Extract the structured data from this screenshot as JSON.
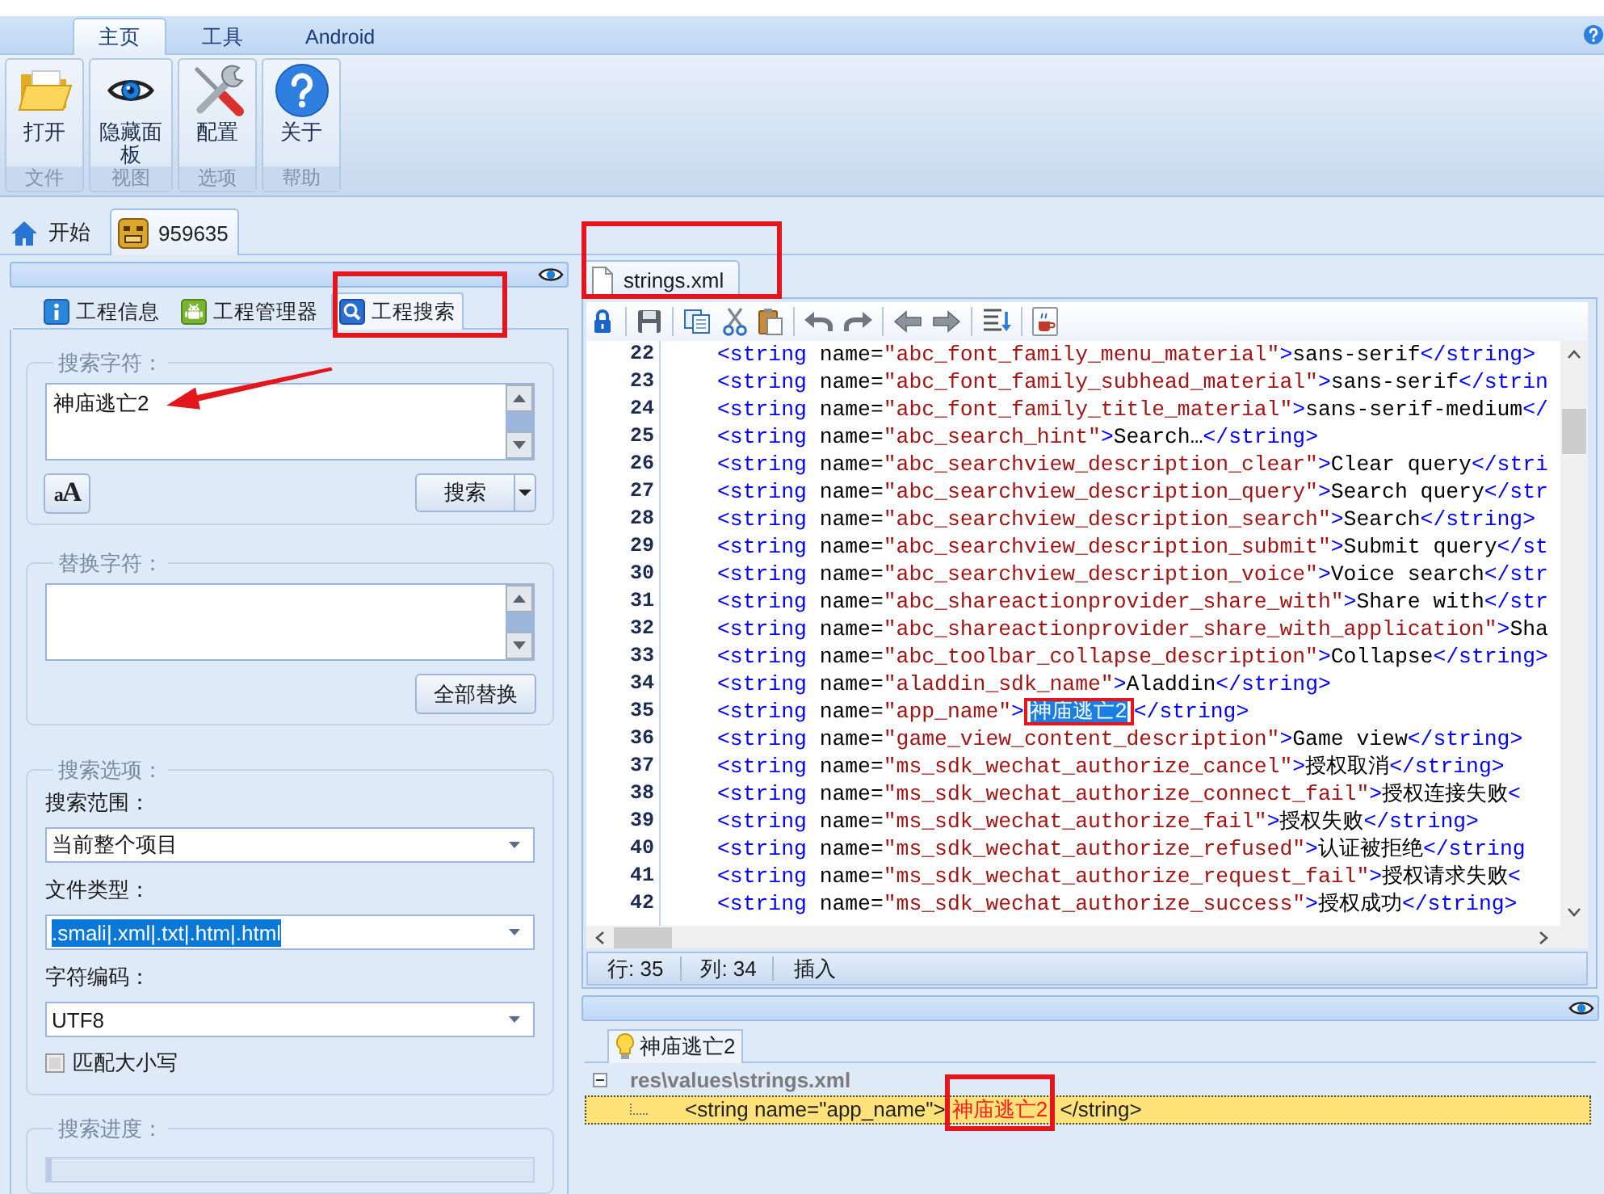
{
  "ribbon": {
    "tabs": [
      {
        "label": "主页",
        "selected": true
      },
      {
        "label": "工具",
        "selected": false
      },
      {
        "label": "Android",
        "selected": false
      }
    ],
    "groups": [
      {
        "button": "打开",
        "label": "文件"
      },
      {
        "button": "隐藏面板",
        "label": "视图"
      },
      {
        "button": "配置",
        "label": "选项"
      },
      {
        "button": "关于",
        "label": "帮助"
      }
    ]
  },
  "document_tabs": [
    {
      "label": "开始",
      "selected": false
    },
    {
      "label": "959635",
      "selected": true
    }
  ],
  "left_panel": {
    "tabs": [
      {
        "label": "工程信息",
        "selected": false,
        "marked": false
      },
      {
        "label": "工程管理器",
        "selected": false,
        "marked": false
      },
      {
        "label": "工程搜索",
        "selected": true,
        "marked": true
      }
    ],
    "search_group": {
      "legend": "搜索字符：",
      "value": "神庙逃亡2",
      "arrow": true,
      "format_button": "aA",
      "search_button": "搜索"
    },
    "replace_group": {
      "legend": "替换字符：",
      "button": "全部替换"
    },
    "options_group": {
      "legend": "搜索选项：",
      "fields": [
        {
          "label": "搜索范围：",
          "value": "当前整个项目",
          "text_selected": false
        },
        {
          "label": "文件类型：",
          "value": ".smali|.xml|.txt|.htm|.html",
          "text_selected": true
        },
        {
          "label": "字符编码：",
          "value": "UTF8",
          "text_selected": false
        }
      ],
      "match_case": {
        "label": "匹配大小写",
        "checked": false
      }
    },
    "progress_group": {
      "legend": "搜索进度：",
      "level": 0
    }
  },
  "editor": {
    "tabs": [
      {
        "label": "strings.xml",
        "selected": true,
        "marked": true
      }
    ],
    "lines": [
      {
        "number": "22",
        "text": "<string name=\"abc_font_family_menu_material\">sans-serif</string>"
      },
      {
        "number": "23",
        "text": "<string name=\"abc_font_family_subhead_material\">sans-serif</strin"
      },
      {
        "number": "24",
        "text": "<string name=\"abc_font_family_title_material\">sans-serif-medium</"
      },
      {
        "number": "25",
        "text": "<string name=\"abc_search_hint\">Search…</string>"
      },
      {
        "number": "26",
        "text": "<string name=\"abc_searchview_description_clear\">Clear query</stri"
      },
      {
        "number": "27",
        "text": "<string name=\"abc_searchview_description_query\">Search query</str"
      },
      {
        "number": "28",
        "text": "<string name=\"abc_searchview_description_search\">Search</string>"
      },
      {
        "number": "29",
        "text": "<string name=\"abc_searchview_description_submit\">Submit query</st"
      },
      {
        "number": "30",
        "text": "<string name=\"abc_searchview_description_voice\">Voice search</str"
      },
      {
        "number": "31",
        "text": "<string name=\"abc_shareactionprovider_share_with\">Share with</str"
      },
      {
        "number": "32",
        "text": "<string name=\"abc_shareactionprovider_share_with_application\">Sha"
      },
      {
        "number": "33",
        "text": "<string name=\"abc_toolbar_collapse_description\">Collapse</string>"
      },
      {
        "number": "34",
        "text": "<string name=\"aladdin_sdk_name\">Aladdin</string>"
      },
      {
        "number": "35",
        "text": "<string name=\"app_name\">",
        "selection": {
          "text": "神庙逃亡2",
          "marked": true
        },
        "rest": "</string>"
      },
      {
        "number": "36",
        "text": "<string name=\"game_view_content_description\">Game view</string>"
      },
      {
        "number": "37",
        "text": "<string name=\"ms_sdk_wechat_authorize_cancel\">授权取消</string>"
      },
      {
        "number": "38",
        "text": "<string name=\"ms_sdk_wechat_authorize_connect_fail\">授权连接失败<"
      },
      {
        "number": "39",
        "text": "<string name=\"ms_sdk_wechat_authorize_fail\">授权失败</string>"
      },
      {
        "number": "40",
        "text": "<string name=\"ms_sdk_wechat_authorize_refused\">认证被拒绝</string"
      },
      {
        "number": "41",
        "text": "<string name=\"ms_sdk_wechat_authorize_request_fail\">授权请求失败<"
      },
      {
        "number": "42",
        "text": "<string name=\"ms_sdk_wechat_authorize_success\">授权成功</string>"
      }
    ],
    "status": {
      "line": "行: 35",
      "column": "列: 34",
      "mode": "插入"
    }
  },
  "results": {
    "tabs": [
      {
        "label": "神庙逃亡2",
        "selected": true
      }
    ],
    "tree": [
      {
        "label": "res\\values\\strings.xml",
        "expanded": true,
        "children": [
          {
            "before": "<string name=\"app_name\">",
            "match": "神庙逃亡2",
            "after": " </string>",
            "selected": true,
            "marked": true
          }
        ]
      }
    ]
  }
}
